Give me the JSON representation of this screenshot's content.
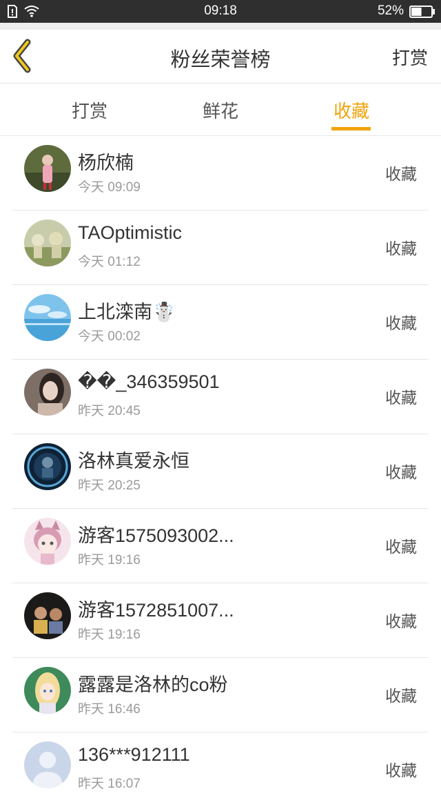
{
  "status_bar": {
    "time": "09:18",
    "battery": "52%",
    "battery_level": 0.52
  },
  "header": {
    "title": "粉丝荣誉榜",
    "right_action": "打赏"
  },
  "tabs": [
    {
      "label": "打赏",
      "active": false
    },
    {
      "label": "鲜花",
      "active": false
    },
    {
      "label": "收藏",
      "active": true
    }
  ],
  "colors": {
    "accent": "#f0a30a",
    "text": "#333333",
    "muted": "#9a9a9a"
  },
  "fans": [
    {
      "name": "杨欣楠",
      "time": "今天 09:09",
      "action": "收藏"
    },
    {
      "name": "TAOptimistic",
      "time": "今天 01:12",
      "action": "收藏"
    },
    {
      "name": "上北滦南☃️",
      "time": "今天 00:02",
      "action": "收藏"
    },
    {
      "name": "��_346359501",
      "time": "昨天 20:45",
      "action": "收藏"
    },
    {
      "name": "洛林真爱永恒",
      "time": "昨天 20:25",
      "action": "收藏"
    },
    {
      "name": "游客1575093002...",
      "time": "昨天 19:16",
      "action": "收藏"
    },
    {
      "name": "游客1572851007...",
      "time": "昨天 19:16",
      "action": "收藏"
    },
    {
      "name": "露露是洛林的co粉",
      "time": "昨天 16:46",
      "action": "收藏"
    },
    {
      "name": "136***912111",
      "time": "昨天 16:07",
      "action": "收藏"
    }
  ]
}
